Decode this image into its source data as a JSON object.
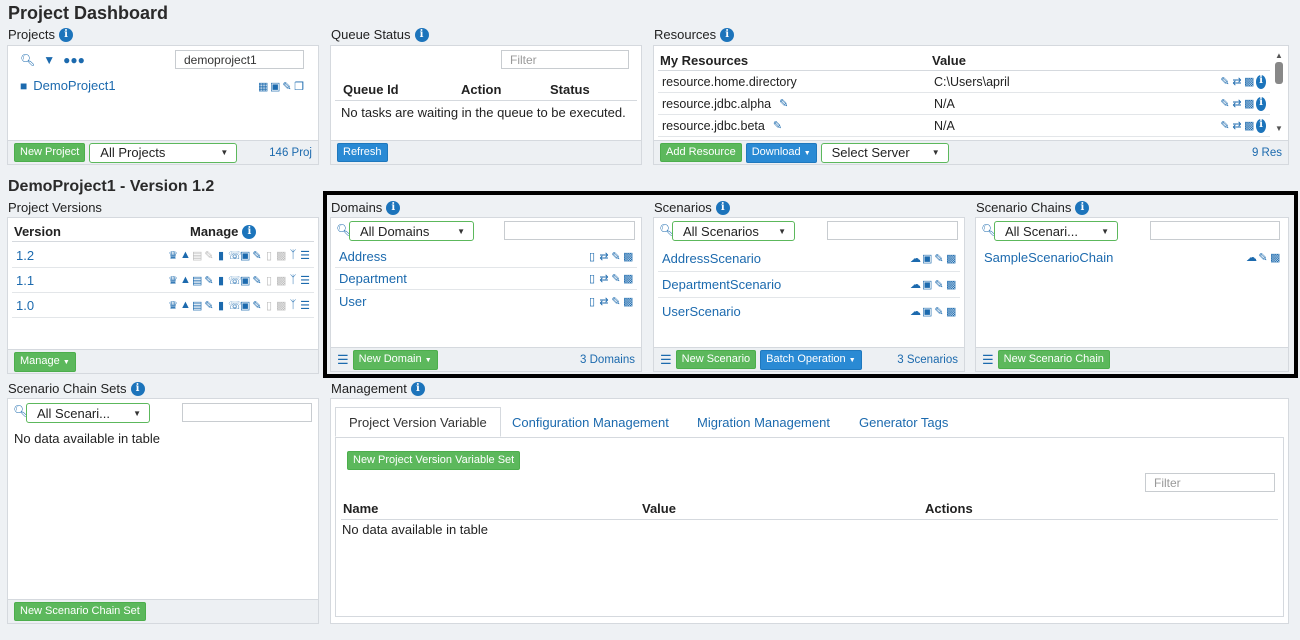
{
  "page_title": "Project Dashboard",
  "projects": {
    "title": "Projects",
    "search_value": "demoproject1",
    "item": "DemoProject1",
    "new_button": "New Project",
    "filter_select": "All Projects",
    "count": "146 Proj"
  },
  "queue": {
    "title": "Queue Status",
    "filter_placeholder": "Filter",
    "columns": [
      "Queue Id",
      "Action",
      "Status"
    ],
    "empty": "No tasks are waiting in the queue to be executed.",
    "refresh_button": "Refresh"
  },
  "resources": {
    "title": "Resources",
    "columns": [
      "My Resources",
      "Value"
    ],
    "rows": [
      {
        "name": "resource.home.directory",
        "value": "C:\\Users\\april"
      },
      {
        "name": "resource.jdbc.alpha",
        "value": "N/A"
      },
      {
        "name": "resource.jdbc.beta",
        "value": "N/A"
      }
    ],
    "add_button": "Add Resource",
    "download_button": "Download",
    "server_select": "Select Server",
    "count": "9 Res"
  },
  "version_title": "DemoProject1 - Version 1.2",
  "versions": {
    "title": "Project Versions",
    "columns": [
      "Version",
      "Manage"
    ],
    "rows": [
      "1.2",
      "1.1",
      "1.0"
    ],
    "manage_button": "Manage"
  },
  "domains": {
    "title": "Domains",
    "select": "All Domains",
    "items": [
      "Address",
      "Department",
      "User"
    ],
    "new_button": "New Domain",
    "count": "3 Domains"
  },
  "scenarios": {
    "title": "Scenarios",
    "select": "All Scenarios",
    "items": [
      "AddressScenario",
      "DepartmentScenario",
      "UserScenario"
    ],
    "new_button": "New Scenario",
    "batch_button": "Batch Operation",
    "count": "3 Scenarios"
  },
  "chains": {
    "title": "Scenario Chains",
    "select": "All Scenari...",
    "items": [
      "SampleScenarioChain"
    ],
    "new_button": "New Scenario Chain"
  },
  "chain_sets": {
    "title": "Scenario Chain Sets",
    "select": "All Scenari...",
    "empty": "No data available in table",
    "new_button": "New Scenario Chain Set"
  },
  "management": {
    "title": "Management",
    "tabs": [
      "Project Version Variable",
      "Configuration Management",
      "Migration Management",
      "Generator Tags"
    ],
    "new_button": "New Project Version Variable Set",
    "filter_placeholder": "Filter",
    "columns": [
      "Name",
      "Value",
      "Actions"
    ],
    "empty": "No data available in table"
  },
  "colors": {
    "accent": "#1c6aae",
    "green": "#5cb85c",
    "highlight_border": "#000000"
  }
}
